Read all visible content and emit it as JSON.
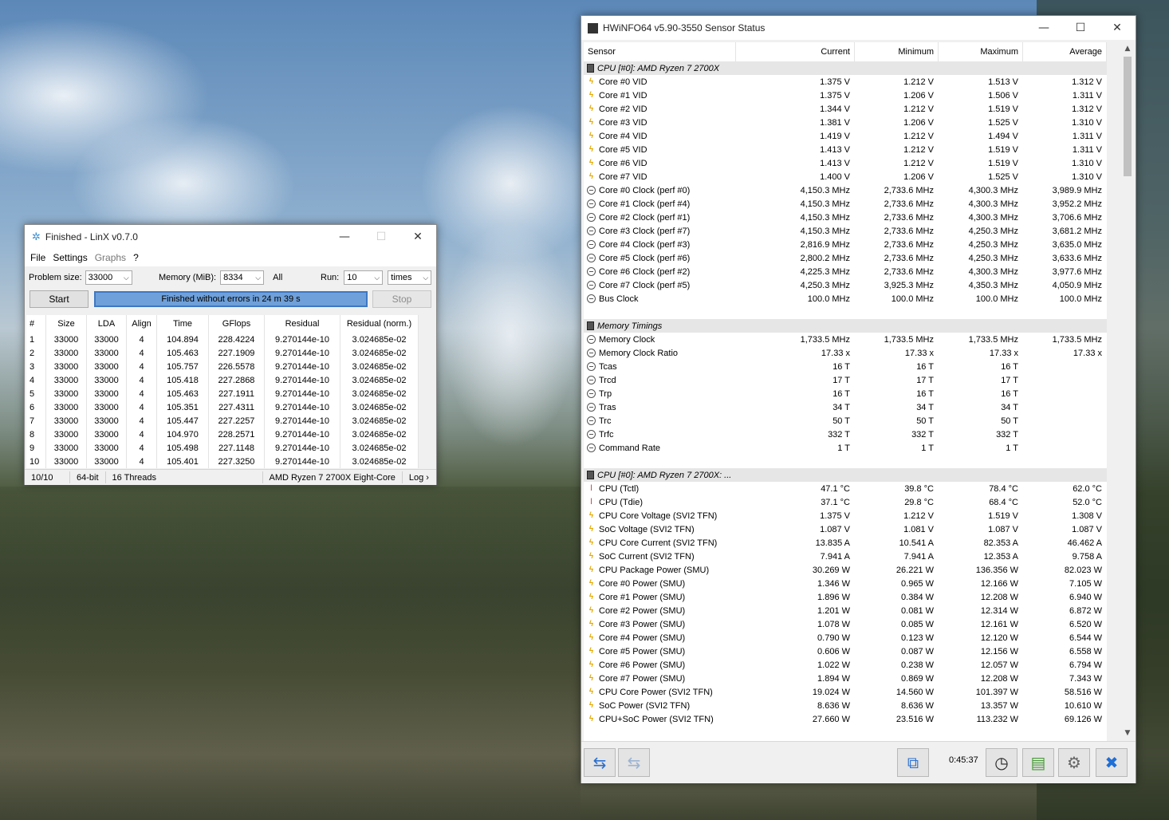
{
  "linx": {
    "title": "Finished - LinX v0.7.0",
    "menu": [
      "File",
      "Settings",
      "Graphs",
      "?"
    ],
    "problem_size_label": "Problem size:",
    "problem_size_value": "33000",
    "memory_label": "Memory (MiB):",
    "memory_value": "8334",
    "all_label": "All",
    "run_label": "Run:",
    "run_value": "10",
    "times_value": "times",
    "start_label": "Start",
    "progress_text": "Finished without errors in 24 m 39 s",
    "progress_fraction": 1.0,
    "stop_label": "Stop",
    "columns": [
      "#",
      "Size",
      "LDA",
      "Align",
      "Time",
      "GFlops",
      "Residual",
      "Residual (norm.)"
    ],
    "rows": [
      [
        "1",
        "33000",
        "33000",
        "4",
        "104.894",
        "228.4224",
        "9.270144e-10",
        "3.024685e-02"
      ],
      [
        "2",
        "33000",
        "33000",
        "4",
        "105.463",
        "227.1909",
        "9.270144e-10",
        "3.024685e-02"
      ],
      [
        "3",
        "33000",
        "33000",
        "4",
        "105.757",
        "226.5578",
        "9.270144e-10",
        "3.024685e-02"
      ],
      [
        "4",
        "33000",
        "33000",
        "4",
        "105.418",
        "227.2868",
        "9.270144e-10",
        "3.024685e-02"
      ],
      [
        "5",
        "33000",
        "33000",
        "4",
        "105.463",
        "227.1911",
        "9.270144e-10",
        "3.024685e-02"
      ],
      [
        "6",
        "33000",
        "33000",
        "4",
        "105.351",
        "227.4311",
        "9.270144e-10",
        "3.024685e-02"
      ],
      [
        "7",
        "33000",
        "33000",
        "4",
        "105.447",
        "227.2257",
        "9.270144e-10",
        "3.024685e-02"
      ],
      [
        "8",
        "33000",
        "33000",
        "4",
        "104.970",
        "228.2571",
        "9.270144e-10",
        "3.024685e-02"
      ],
      [
        "9",
        "33000",
        "33000",
        "4",
        "105.498",
        "227.1148",
        "9.270144e-10",
        "3.024685e-02"
      ],
      [
        "10",
        "33000",
        "33000",
        "4",
        "105.401",
        "227.3250",
        "9.270144e-10",
        "3.024685e-02"
      ]
    ],
    "status": [
      "10/10",
      "64-bit",
      "16 Threads",
      "AMD Ryzen 7 2700X Eight-Core",
      "Log ›"
    ]
  },
  "hwinfo": {
    "title": "HWiNFO64 v5.90-3550 Sensor Status",
    "columns": [
      "Sensor",
      "Current",
      "Minimum",
      "Maximum",
      "Average"
    ],
    "rows": [
      {
        "type": "group",
        "name": "CPU [#0]: AMD Ryzen 7 2700X"
      },
      {
        "icon": "bolt",
        "name": "Core #0 VID",
        "cur": "1.375 V",
        "min": "1.212 V",
        "max": "1.513 V",
        "avg": "1.312 V"
      },
      {
        "icon": "bolt",
        "name": "Core #1 VID",
        "cur": "1.375 V",
        "min": "1.206 V",
        "max": "1.506 V",
        "avg": "1.311 V"
      },
      {
        "icon": "bolt",
        "name": "Core #2 VID",
        "cur": "1.344 V",
        "min": "1.212 V",
        "max": "1.519 V",
        "avg": "1.312 V"
      },
      {
        "icon": "bolt",
        "name": "Core #3 VID",
        "cur": "1.381 V",
        "min": "1.206 V",
        "max": "1.525 V",
        "avg": "1.310 V"
      },
      {
        "icon": "bolt",
        "name": "Core #4 VID",
        "cur": "1.419 V",
        "min": "1.212 V",
        "max": "1.494 V",
        "avg": "1.311 V"
      },
      {
        "icon": "bolt",
        "name": "Core #5 VID",
        "cur": "1.413 V",
        "min": "1.212 V",
        "max": "1.519 V",
        "avg": "1.311 V"
      },
      {
        "icon": "bolt",
        "name": "Core #6 VID",
        "cur": "1.413 V",
        "min": "1.212 V",
        "max": "1.519 V",
        "avg": "1.310 V"
      },
      {
        "icon": "bolt",
        "name": "Core #7 VID",
        "cur": "1.400 V",
        "min": "1.206 V",
        "max": "1.525 V",
        "avg": "1.310 V"
      },
      {
        "icon": "clock",
        "name": "Core #0 Clock (perf #0)",
        "cur": "4,150.3 MHz",
        "min": "2,733.6 MHz",
        "max": "4,300.3 MHz",
        "avg": "3,989.9 MHz"
      },
      {
        "icon": "clock",
        "name": "Core #1 Clock (perf #4)",
        "cur": "4,150.3 MHz",
        "min": "2,733.6 MHz",
        "max": "4,300.3 MHz",
        "avg": "3,952.2 MHz"
      },
      {
        "icon": "clock",
        "name": "Core #2 Clock (perf #1)",
        "cur": "4,150.3 MHz",
        "min": "2,733.6 MHz",
        "max": "4,300.3 MHz",
        "avg": "3,706.6 MHz"
      },
      {
        "icon": "clock",
        "name": "Core #3 Clock (perf #7)",
        "cur": "4,150.3 MHz",
        "min": "2,733.6 MHz",
        "max": "4,250.3 MHz",
        "avg": "3,681.2 MHz"
      },
      {
        "icon": "clock",
        "name": "Core #4 Clock (perf #3)",
        "cur": "2,816.9 MHz",
        "min": "2,733.6 MHz",
        "max": "4,250.3 MHz",
        "avg": "3,635.0 MHz"
      },
      {
        "icon": "clock",
        "name": "Core #5 Clock (perf #6)",
        "cur": "2,800.2 MHz",
        "min": "2,733.6 MHz",
        "max": "4,250.3 MHz",
        "avg": "3,633.6 MHz"
      },
      {
        "icon": "clock",
        "name": "Core #6 Clock (perf #2)",
        "cur": "4,225.3 MHz",
        "min": "2,733.6 MHz",
        "max": "4,300.3 MHz",
        "avg": "3,977.6 MHz"
      },
      {
        "icon": "clock",
        "name": "Core #7 Clock (perf #5)",
        "cur": "4,250.3 MHz",
        "min": "3,925.3 MHz",
        "max": "4,350.3 MHz",
        "avg": "4,050.9 MHz"
      },
      {
        "icon": "clock",
        "name": "Bus Clock",
        "cur": "100.0 MHz",
        "min": "100.0 MHz",
        "max": "100.0 MHz",
        "avg": "100.0 MHz"
      },
      {
        "type": "blank"
      },
      {
        "type": "group",
        "name": "Memory Timings"
      },
      {
        "icon": "clock",
        "name": "Memory Clock",
        "cur": "1,733.5 MHz",
        "min": "1,733.5 MHz",
        "max": "1,733.5 MHz",
        "avg": "1,733.5 MHz"
      },
      {
        "icon": "clock",
        "name": "Memory Clock Ratio",
        "cur": "17.33 x",
        "min": "17.33 x",
        "max": "17.33 x",
        "avg": "17.33 x"
      },
      {
        "icon": "clock",
        "name": "Tcas",
        "cur": "16 T",
        "min": "16 T",
        "max": "16 T",
        "avg": ""
      },
      {
        "icon": "clock",
        "name": "Trcd",
        "cur": "17 T",
        "min": "17 T",
        "max": "17 T",
        "avg": ""
      },
      {
        "icon": "clock",
        "name": "Trp",
        "cur": "16 T",
        "min": "16 T",
        "max": "16 T",
        "avg": ""
      },
      {
        "icon": "clock",
        "name": "Tras",
        "cur": "34 T",
        "min": "34 T",
        "max": "34 T",
        "avg": ""
      },
      {
        "icon": "clock",
        "name": "Trc",
        "cur": "50 T",
        "min": "50 T",
        "max": "50 T",
        "avg": ""
      },
      {
        "icon": "clock",
        "name": "Trfc",
        "cur": "332 T",
        "min": "332 T",
        "max": "332 T",
        "avg": ""
      },
      {
        "icon": "clock",
        "name": "Command Rate",
        "cur": "1 T",
        "min": "1 T",
        "max": "1 T",
        "avg": ""
      },
      {
        "type": "blank"
      },
      {
        "type": "group",
        "name": "CPU [#0]: AMD Ryzen 7 2700X: ..."
      },
      {
        "icon": "therm",
        "name": "CPU (Tctl)",
        "cur": "47.1 °C",
        "min": "39.8 °C",
        "max": "78.4 °C",
        "avg": "62.0 °C"
      },
      {
        "icon": "therm",
        "name": "CPU (Tdie)",
        "cur": "37.1 °C",
        "min": "29.8 °C",
        "max": "68.4 °C",
        "avg": "52.0 °C"
      },
      {
        "icon": "bolt",
        "name": "CPU Core Voltage (SVI2 TFN)",
        "cur": "1.375 V",
        "min": "1.212 V",
        "max": "1.519 V",
        "avg": "1.308 V"
      },
      {
        "icon": "bolt",
        "name": "SoC Voltage (SVI2 TFN)",
        "cur": "1.087 V",
        "min": "1.081 V",
        "max": "1.087 V",
        "avg": "1.087 V"
      },
      {
        "icon": "bolt",
        "name": "CPU Core Current (SVI2 TFN)",
        "cur": "13.835 A",
        "min": "10.541 A",
        "max": "82.353 A",
        "avg": "46.462 A"
      },
      {
        "icon": "bolt",
        "name": "SoC Current (SVI2 TFN)",
        "cur": "7.941 A",
        "min": "7.941 A",
        "max": "12.353 A",
        "avg": "9.758 A"
      },
      {
        "icon": "bolt",
        "name": "CPU Package Power (SMU)",
        "cur": "30.269 W",
        "min": "26.221 W",
        "max": "136.356 W",
        "avg": "82.023 W"
      },
      {
        "icon": "bolt",
        "name": "Core #0 Power (SMU)",
        "cur": "1.346 W",
        "min": "0.965 W",
        "max": "12.166 W",
        "avg": "7.105 W"
      },
      {
        "icon": "bolt",
        "name": "Core #1 Power (SMU)",
        "cur": "1.896 W",
        "min": "0.384 W",
        "max": "12.208 W",
        "avg": "6.940 W"
      },
      {
        "icon": "bolt",
        "name": "Core #2 Power (SMU)",
        "cur": "1.201 W",
        "min": "0.081 W",
        "max": "12.314 W",
        "avg": "6.872 W"
      },
      {
        "icon": "bolt",
        "name": "Core #3 Power (SMU)",
        "cur": "1.078 W",
        "min": "0.085 W",
        "max": "12.161 W",
        "avg": "6.520 W"
      },
      {
        "icon": "bolt",
        "name": "Core #4 Power (SMU)",
        "cur": "0.790 W",
        "min": "0.123 W",
        "max": "12.120 W",
        "avg": "6.544 W"
      },
      {
        "icon": "bolt",
        "name": "Core #5 Power (SMU)",
        "cur": "0.606 W",
        "min": "0.087 W",
        "max": "12.156 W",
        "avg": "6.558 W"
      },
      {
        "icon": "bolt",
        "name": "Core #6 Power (SMU)",
        "cur": "1.022 W",
        "min": "0.238 W",
        "max": "12.057 W",
        "avg": "6.794 W"
      },
      {
        "icon": "bolt",
        "name": "Core #7 Power (SMU)",
        "cur": "1.894 W",
        "min": "0.869 W",
        "max": "12.208 W",
        "avg": "7.343 W"
      },
      {
        "icon": "bolt",
        "name": "CPU Core Power (SVI2 TFN)",
        "cur": "19.024 W",
        "min": "14.560 W",
        "max": "101.397 W",
        "avg": "58.516 W"
      },
      {
        "icon": "bolt",
        "name": "SoC Power (SVI2 TFN)",
        "cur": "8.636 W",
        "min": "8.636 W",
        "max": "13.357 W",
        "avg": "10.610 W"
      },
      {
        "icon": "bolt",
        "name": "CPU+SoC Power (SVI2 TFN)",
        "cur": "27.660 W",
        "min": "23.516 W",
        "max": "113.232 W",
        "avg": "69.126 W"
      }
    ],
    "timer": "0:45:37",
    "toolbar_icons": [
      "nav-arrows-icon",
      "nav-arrows-disabled-icon",
      "network-icon",
      "clock-icon",
      "add-report-icon",
      "settings-icon",
      "close-icon"
    ]
  },
  "colors": {
    "progress_fill": "#6fa0d9",
    "progress_border": "#3e78c4",
    "group_row": "#e6e6e6"
  }
}
